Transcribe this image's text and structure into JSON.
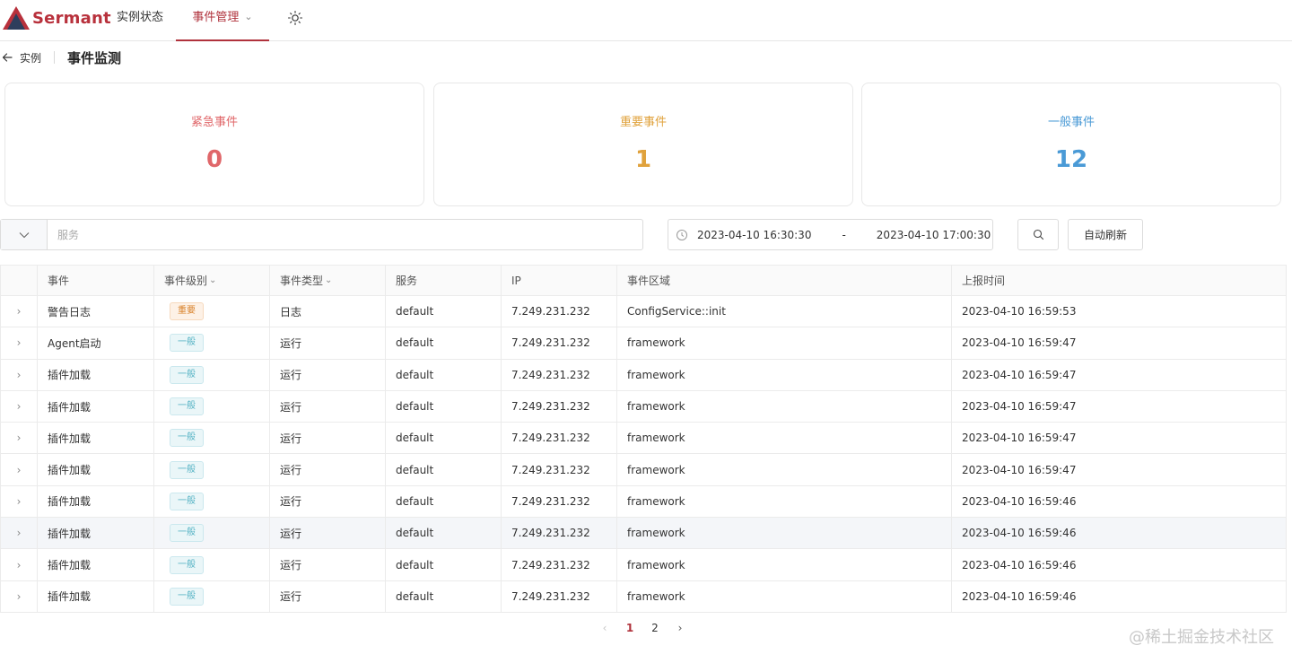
{
  "brand": {
    "name": "Sermant",
    "color": "#b8313c"
  },
  "nav": {
    "items": [
      {
        "label": "实例状态"
      },
      {
        "label": "事件管理"
      }
    ],
    "theme_icon": "sun-icon"
  },
  "breadcrumb": {
    "back_label": "实例",
    "title": "事件监测"
  },
  "stats": [
    {
      "label": "紧急事件",
      "value": "0",
      "color": "#e0676a"
    },
    {
      "label": "重要事件",
      "value": "1",
      "color": "#e0a23c"
    },
    {
      "label": "一般事件",
      "value": "12",
      "color": "#4a9ad6"
    }
  ],
  "filters": {
    "service_placeholder": "服务",
    "date_start": "2023-04-10 16:30:30",
    "date_separator": "-",
    "date_end": "2023-04-10 17:00:30",
    "refresh_label": "自动刷新"
  },
  "table": {
    "columns": [
      "事件",
      "事件级别",
      "事件类型",
      "服务",
      "IP",
      "事件区域",
      "上报时间"
    ],
    "rows": [
      {
        "event": "警告日志",
        "level": "重要",
        "type": "日志",
        "service": "default",
        "ip": "7.249.231.232",
        "area": "ConfigService::init",
        "time": "2023-04-10 16:59:53"
      },
      {
        "event": "Agent启动",
        "level": "一般",
        "type": "运行",
        "service": "default",
        "ip": "7.249.231.232",
        "area": "framework",
        "time": "2023-04-10 16:59:47"
      },
      {
        "event": "插件加载",
        "level": "一般",
        "type": "运行",
        "service": "default",
        "ip": "7.249.231.232",
        "area": "framework",
        "time": "2023-04-10 16:59:47"
      },
      {
        "event": "插件加载",
        "level": "一般",
        "type": "运行",
        "service": "default",
        "ip": "7.249.231.232",
        "area": "framework",
        "time": "2023-04-10 16:59:47"
      },
      {
        "event": "插件加载",
        "level": "一般",
        "type": "运行",
        "service": "default",
        "ip": "7.249.231.232",
        "area": "framework",
        "time": "2023-04-10 16:59:47"
      },
      {
        "event": "插件加载",
        "level": "一般",
        "type": "运行",
        "service": "default",
        "ip": "7.249.231.232",
        "area": "framework",
        "time": "2023-04-10 16:59:47"
      },
      {
        "event": "插件加载",
        "level": "一般",
        "type": "运行",
        "service": "default",
        "ip": "7.249.231.232",
        "area": "framework",
        "time": "2023-04-10 16:59:46"
      },
      {
        "event": "插件加载",
        "level": "一般",
        "type": "运行",
        "service": "default",
        "ip": "7.249.231.232",
        "area": "framework",
        "time": "2023-04-10 16:59:46"
      },
      {
        "event": "插件加载",
        "level": "一般",
        "type": "运行",
        "service": "default",
        "ip": "7.249.231.232",
        "area": "framework",
        "time": "2023-04-10 16:59:46"
      },
      {
        "event": "插件加载",
        "level": "一般",
        "type": "运行",
        "service": "default",
        "ip": "7.249.231.232",
        "area": "framework",
        "time": "2023-04-10 16:59:46"
      }
    ]
  },
  "pagination": {
    "pages": [
      "1",
      "2"
    ],
    "current": "1"
  },
  "watermark": "@稀土掘金技术社区"
}
